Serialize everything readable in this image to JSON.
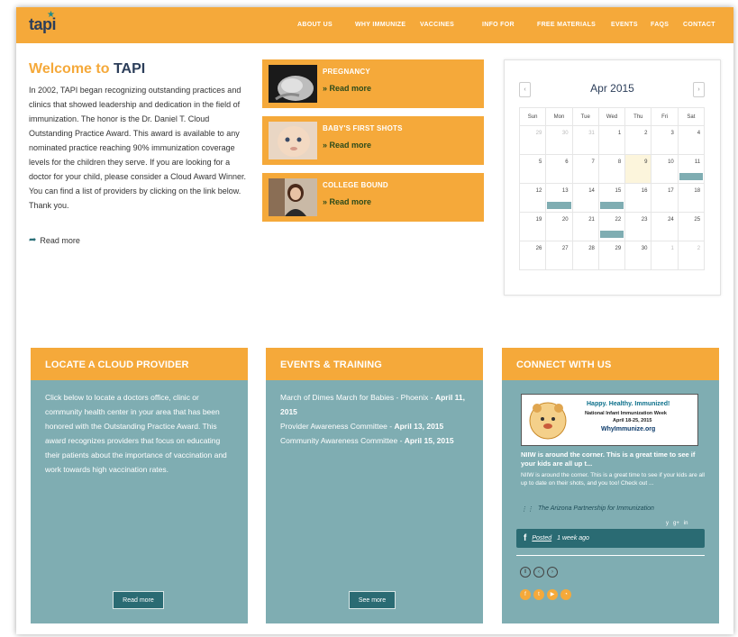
{
  "header": {
    "logo": {
      "text": "tapi"
    },
    "nav": [
      "ABOUT US",
      "WHY IMMUNIZE",
      "VACCINES",
      "INFO FOR",
      "FREE MATERIALS",
      "EVENTS",
      "FAQS",
      "CONTACT"
    ]
  },
  "welcome": {
    "title_prefix": "Welcome to ",
    "title_brand": "TAPI",
    "body": "In 2002, TAPI began recognizing outstanding practices and clinics that showed leadership and dedication in the field of immunization. The honor is the Dr. Daniel T. Cloud Outstanding Practice Award. This award is available to any nominated practice reaching 90% immunization coverage levels for the children they serve. If you are looking for a doctor for your child, please consider a Cloud Award Winner. You can find a list of providers by clicking on the link below. Thank you.",
    "read_more": "Read more"
  },
  "promos": [
    {
      "title": "PREGNANCY",
      "link": "» Read more"
    },
    {
      "title": "BABY'S FIRST SHOTS",
      "link": "» Read more"
    },
    {
      "title": "COLLEGE BOUND",
      "link": "» Read more"
    }
  ],
  "calendar": {
    "month": "Apr 2015",
    "prev": "‹",
    "next": "›",
    "weekdays": [
      "Sun",
      "Mon",
      "Tue",
      "Wed",
      "Thu",
      "Fri",
      "Sat"
    ],
    "weeks": [
      [
        "29",
        "30",
        "31",
        "1",
        "2",
        "3",
        "4"
      ],
      [
        "5",
        "6",
        "7",
        "8",
        "9",
        "10",
        "11"
      ],
      [
        "12",
        "13",
        "14",
        "15",
        "16",
        "17",
        "18"
      ],
      [
        "19",
        "20",
        "21",
        "22",
        "23",
        "24",
        "25"
      ],
      [
        "26",
        "27",
        "28",
        "29",
        "30",
        "1",
        "2"
      ]
    ]
  },
  "cards": {
    "locate": {
      "title": "LOCATE A CLOUD PROVIDER",
      "body": "Click below to locate a doctors office, clinic or community health center  in your area that has been honored with the Outstanding Practice Award. This award recognizes providers that focus on educating their patients about the importance of vaccination and work towards high vaccination rates.",
      "button": "Read more"
    },
    "events": {
      "title": "EVENTS & TRAINING",
      "items": [
        {
          "text": "March of Dimes March for Babies - Phoenix - ",
          "date": "April 11, 2015"
        },
        {
          "text": "Provider Awareness Committee - ",
          "date": "April 13, 2015"
        },
        {
          "text": "Community Awareness Committee - ",
          "date": "April 15, 2015"
        }
      ],
      "button": "See more"
    },
    "connect": {
      "title": "CONNECT WITH US",
      "banner": {
        "line1": "Happy. Healthy. Immunized!",
        "line2": "National Infant Immunization Week",
        "line3": "April 18-25, 2015",
        "line4": "WhyImmunize.org"
      },
      "headline": "NIIW is around the corner. This is a great time to see if your kids are all up t...",
      "snippet": "NIIW is around the corner. This is a great time to see if your kids are all up to date on their shots, and you too! Check out ...",
      "source": "The Arizona Partnership for Immunization",
      "share": [
        "y",
        "g+",
        "in"
      ],
      "posted": "Posted",
      "posted_when": "1 week ago"
    }
  },
  "colors": {
    "orange": "#f5a93a",
    "teal": "#7fadb2",
    "dark_teal": "#2a6b73",
    "navy": "#2c3e5a"
  }
}
